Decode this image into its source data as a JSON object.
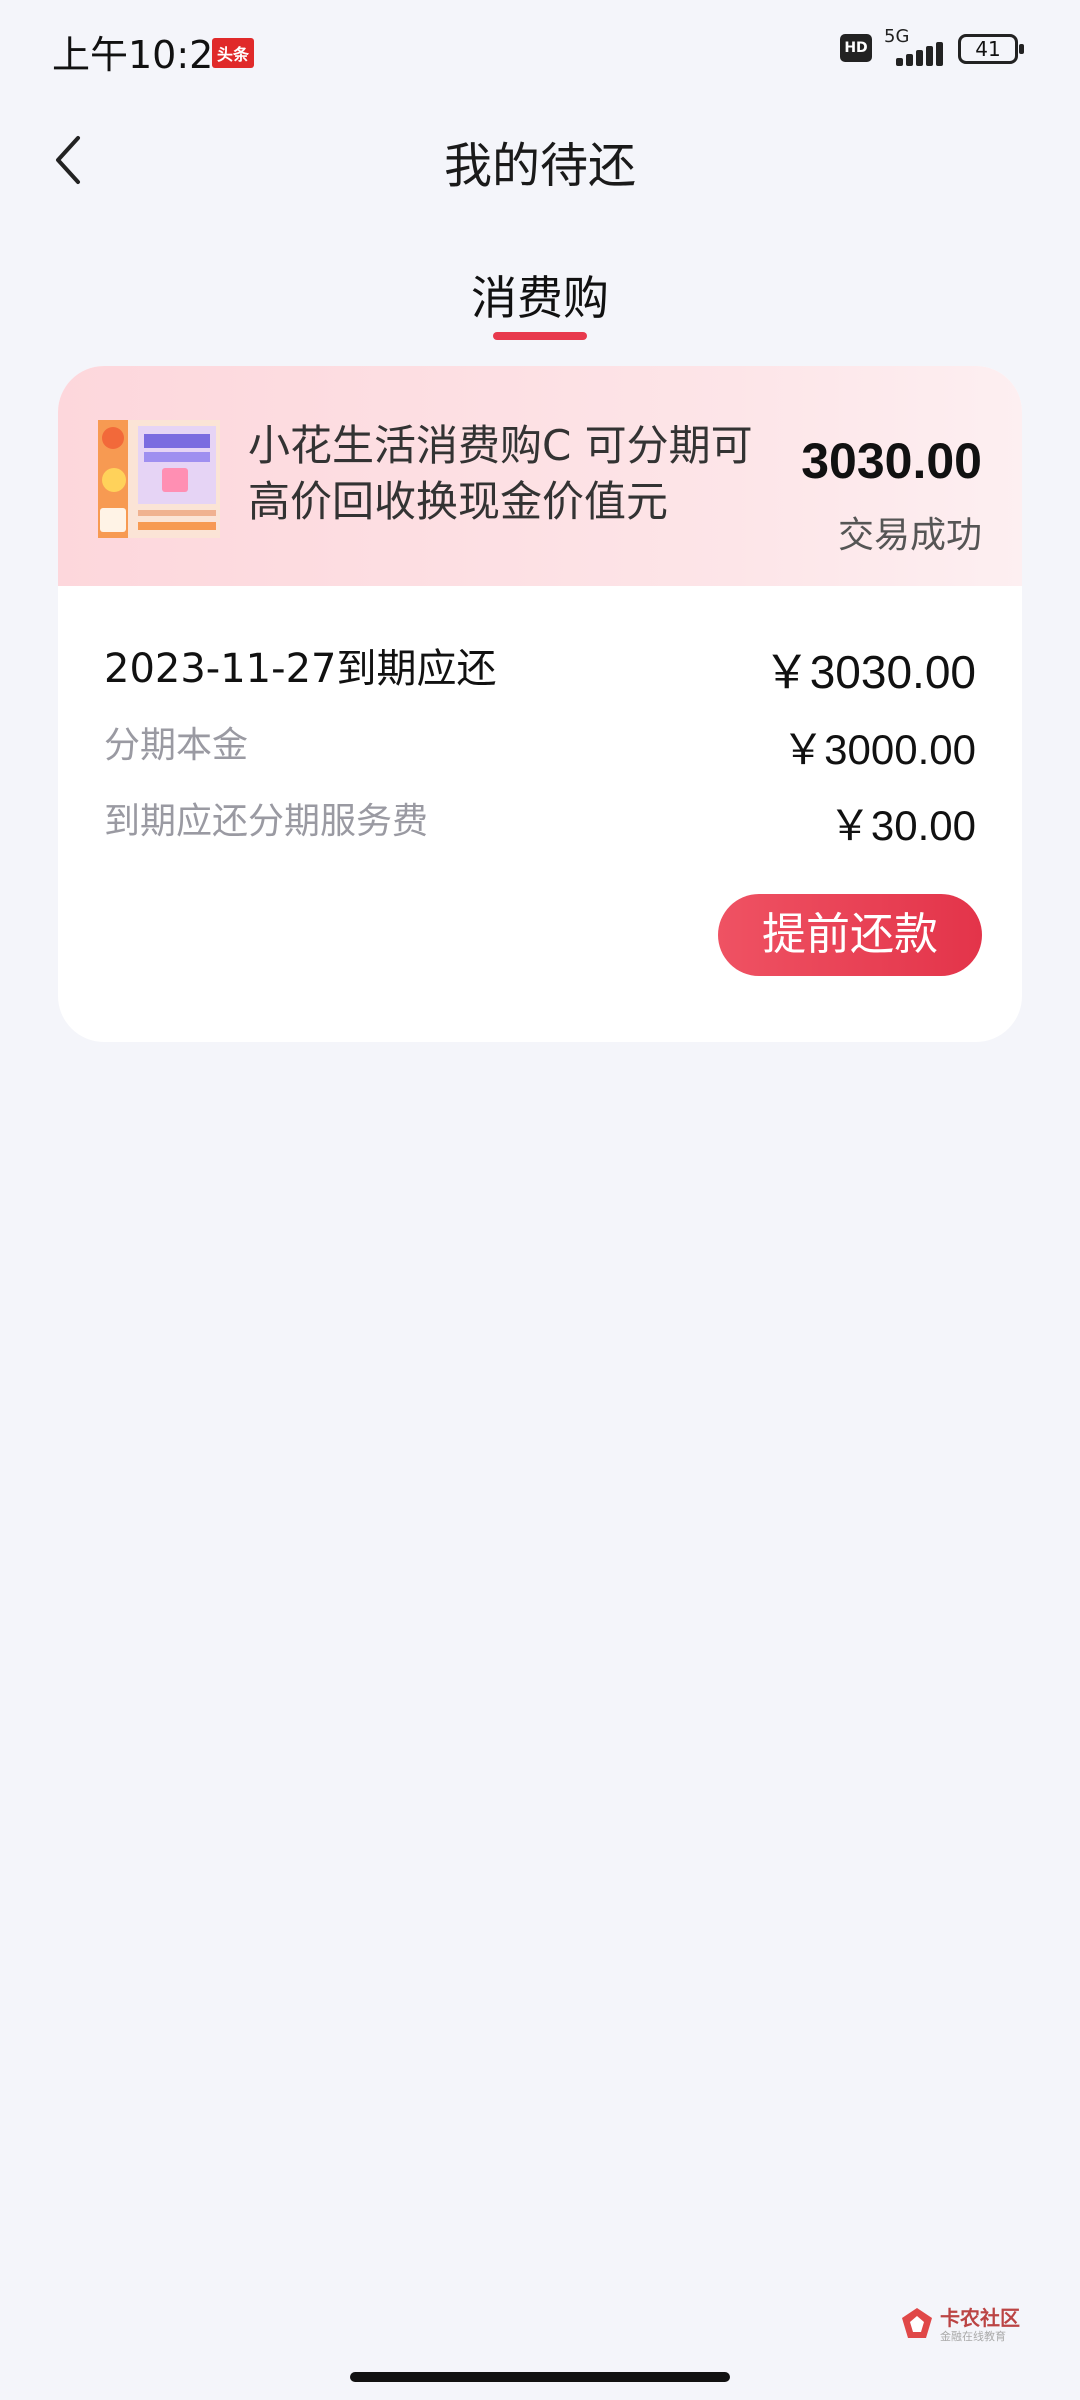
{
  "status_bar": {
    "time": "上午10:21",
    "badge": "头条",
    "hd": "HD",
    "network": "5G",
    "battery": "41"
  },
  "header": {
    "title": "我的待还"
  },
  "tab": {
    "label": "消费购"
  },
  "card": {
    "product_name": "小花生活消费购C 可分期可高价回收换现金价值元",
    "amount": "3030.00",
    "status": "交易成功",
    "due": {
      "label": "2023-11-27到期应还",
      "value": "￥3030.00"
    },
    "principal": {
      "label": "分期本金",
      "value": "￥3000.00"
    },
    "fee": {
      "label": "到期应还分期服务费",
      "value": "￥30.00"
    },
    "repay_button": "提前还款"
  },
  "watermark": {
    "text": "卡农社区",
    "sub": "金融在线教育"
  },
  "colors": {
    "accent": "#e8394d",
    "card_top": "#fdd7dc",
    "background": "#f4f5fa"
  }
}
